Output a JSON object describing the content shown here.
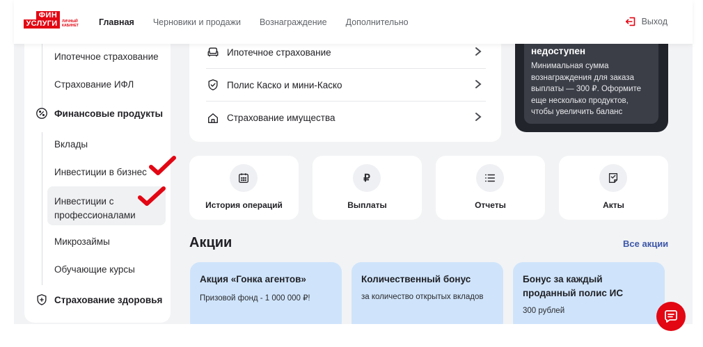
{
  "header": {
    "logo_top": "ФИН",
    "logo_bottom": "УСЛУГИ",
    "logo_sub": "ЛИЧНЫЙ КАБИНЕТ",
    "nav": [
      "Главная",
      "Черновики и продажи",
      "Вознаграждение",
      "Дополнительно"
    ],
    "logout_label": "Выход"
  },
  "sidebar": {
    "insurance_items": [
      "Ипотечное страхование",
      "Страхование ИФЛ"
    ],
    "financial_group": "Финансовые продукты",
    "financial_items": [
      "Вклады",
      "Инвестиции в бизнес",
      "Инвестиции с профессионалами",
      "Микрозаймы",
      "Обучающие курсы"
    ],
    "health_group": "Страхование здоровья"
  },
  "insurance_list": [
    "Ипотечное страхование",
    "Полис Каско и мини-Каско",
    "Страхование имущества"
  ],
  "withdraw_card": {
    "title": "недоступен",
    "text": "Минимальная сумма вознаграждения для заказа выплаты — 300 ₽. Оформите еще несколько продуктов, чтобы увеличить баланс"
  },
  "tiles": [
    {
      "label": "История операций",
      "icon": "calendar-icon"
    },
    {
      "label": "Выплаты",
      "icon": "ruble-icon",
      "glyph": "₽"
    },
    {
      "label": "Отчеты",
      "icon": "list-icon"
    },
    {
      "label": "Акты",
      "icon": "document-icon"
    }
  ],
  "promotions": {
    "title": "Акции",
    "all_link": "Все акции",
    "cards": [
      {
        "title": "Акция «Гонка агентов»",
        "desc": "Призовой фонд - 1 000 000 ₽!"
      },
      {
        "title": "Количественный бонус",
        "desc": "за количество открытых вкладов"
      },
      {
        "title": "Бонус за каждый проданный полис ИС",
        "desc": "300 рублей"
      }
    ]
  },
  "colors": {
    "brand_red": "#e30613",
    "link_blue": "#3d57a8",
    "promo_bg": "#cfe4fb",
    "dark_card": "#22242b"
  }
}
